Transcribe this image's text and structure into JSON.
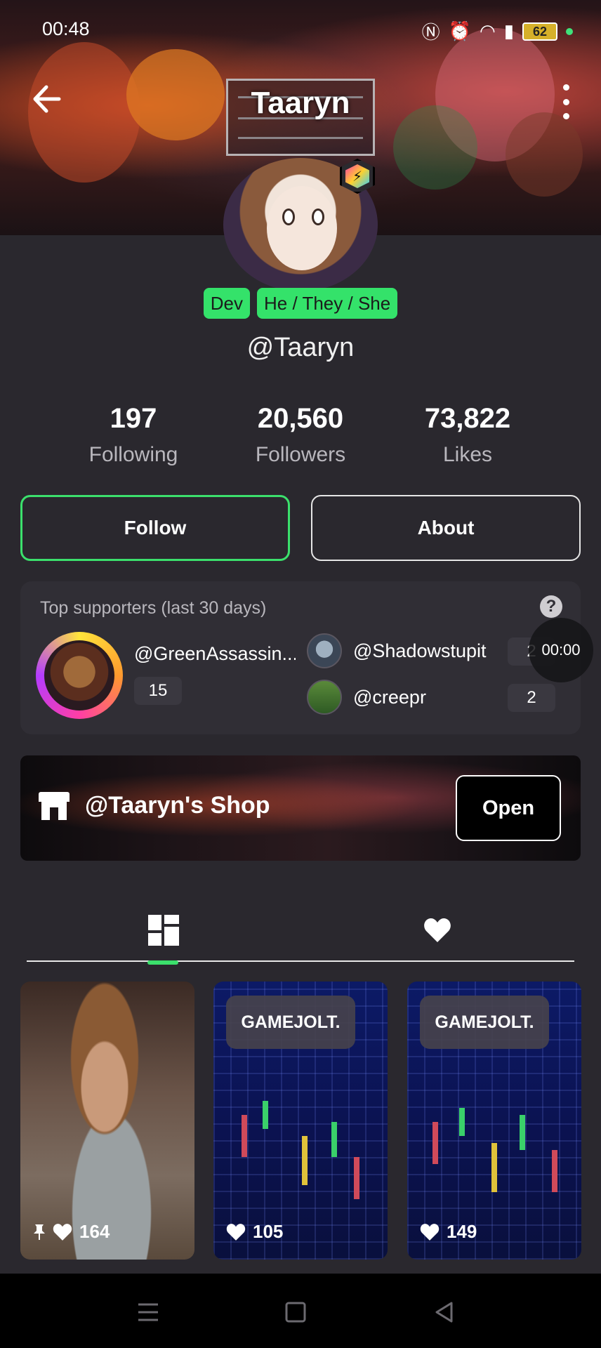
{
  "status_bar": {
    "time": "00:48",
    "battery": "62"
  },
  "header": {
    "title": "Taaryn"
  },
  "profile": {
    "tags": [
      "Dev",
      "He / They / She"
    ],
    "handle": "@Taaryn",
    "stats": [
      {
        "value": "197",
        "label": "Following"
      },
      {
        "value": "20,560",
        "label": "Followers"
      },
      {
        "value": "73,822",
        "label": "Likes"
      }
    ]
  },
  "actions": {
    "follow_label": "Follow",
    "about_label": "About"
  },
  "supporters": {
    "title": "Top supporters (last 30 days)",
    "top": {
      "name": "@GreenAssassin...",
      "count": "15"
    },
    "others": [
      {
        "name": "@Shadowstupit",
        "count": "2"
      },
      {
        "name": "@creepr",
        "count": "2"
      }
    ]
  },
  "overlay_timer": "00:00",
  "shop": {
    "name": "@Taaryn's Shop",
    "open_label": "Open"
  },
  "tabs": {
    "posts_icon": "grid-icon",
    "likes_icon": "heart-icon"
  },
  "posts": [
    {
      "likes": "164",
      "pinned": true,
      "label": ""
    },
    {
      "likes": "105",
      "pinned": false,
      "label": "GAMEJOLT."
    },
    {
      "likes": "149",
      "pinned": false,
      "label": "GAMEJOLT."
    }
  ],
  "colors": {
    "accent": "#3be06c",
    "background": "#2a282e",
    "card": "#302e35"
  }
}
